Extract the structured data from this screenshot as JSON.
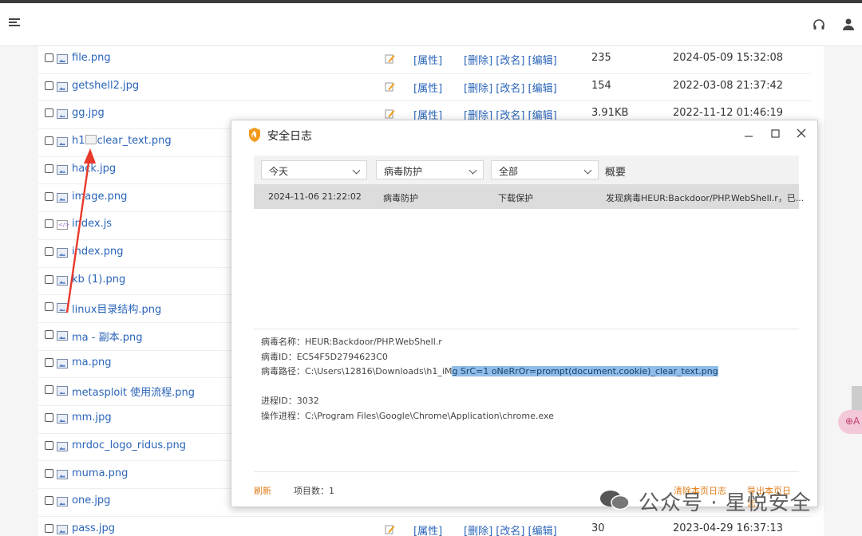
{
  "files": [
    {
      "name": "file.png",
      "type": "image",
      "attr": "[属性]",
      "ops": "[删除] [改名] [编辑]",
      "size": "235",
      "date": "2024-05-09 15:32:08"
    },
    {
      "name": "getshell2.jpg",
      "type": "image",
      "attr": "[属性]",
      "ops": "[删除] [改名] [编辑]",
      "size": "154",
      "date": "2022-03-08 21:37:42"
    },
    {
      "name": "gg.jpg",
      "type": "image",
      "attr": "[属性]",
      "ops": "[删除] [改名] [编辑]",
      "size": "3.91KB",
      "date": "2022-11-12 01:46:19"
    },
    {
      "name_prefix": "h1",
      "name": "clear_text.png",
      "type": "image",
      "broken_img": true
    },
    {
      "name": "hack.jpg",
      "type": "image"
    },
    {
      "name": "image.png",
      "type": "image"
    },
    {
      "name": "index.js",
      "type": "js"
    },
    {
      "name": "index.png",
      "type": "image"
    },
    {
      "name": "kb (1).png",
      "type": "image"
    },
    {
      "name": "linux目录结构.png",
      "type": "image"
    },
    {
      "name": "ma - 副本.png",
      "type": "image"
    },
    {
      "name": "ma.png",
      "type": "image"
    },
    {
      "name": "metasploit 使用流程.png",
      "type": "image"
    },
    {
      "name": "mm.jpg",
      "type": "image"
    },
    {
      "name": "mrdoc_logo_ridus.png",
      "type": "image"
    },
    {
      "name": "muma.png",
      "type": "image"
    },
    {
      "name": "one.jpg",
      "type": "image"
    },
    {
      "name": "pass.jpg",
      "type": "image",
      "attr": "[属性]",
      "ops": "[删除] [改名] [编辑]",
      "size": "30",
      "date": "2023-04-29 16:37:13"
    }
  ],
  "dialog": {
    "title": "安全日志",
    "filters": {
      "time": "今天",
      "category": "病毒防护",
      "scope": "全部"
    },
    "summary_header": "概要",
    "log_row": {
      "time": "2024-11-06 21:22:02",
      "category": "病毒防护",
      "type": "下载保护",
      "summary": "发现病毒HEUR:Backdoor/PHP.WebShell.r，已..."
    },
    "details": {
      "virus_name_label": "病毒名称：",
      "virus_name": "HEUR:Backdoor/PHP.WebShell.r",
      "virus_id_label": "病毒ID：",
      "virus_id": "EC54F5D2794623C0",
      "path_label": "病毒路径：",
      "path_plain": "C:\\Users\\12816\\Downloads\\h1_iM",
      "path_highlight": "g SrC=1 oNeRrOr=prompt(document.cookie)_clear_text.png",
      "pid_label": "进程ID：",
      "pid": "3032",
      "proc_label": "操作进程：",
      "proc": "C:\\Program Files\\Google\\Chrome\\Application\\chrome.exe"
    },
    "footer": {
      "refresh": "刷新",
      "count": "项目数：1",
      "clear": "清除本页日志",
      "export": "导出本页日志"
    }
  },
  "watermark": "公众号 · 星悦安全",
  "side_pill": "⊕A",
  "colors": {
    "link": "#2a64b8",
    "accent": "#e07a16",
    "arrow": "#e8392b",
    "highlight": "#8fbde9"
  },
  "icons": [
    "menu-icon",
    "headphone-icon",
    "user-icon",
    "shield-logo-icon",
    "minimize-icon",
    "maximize-icon",
    "close-icon",
    "edit-icon",
    "image-file-icon",
    "js-file-icon"
  ]
}
